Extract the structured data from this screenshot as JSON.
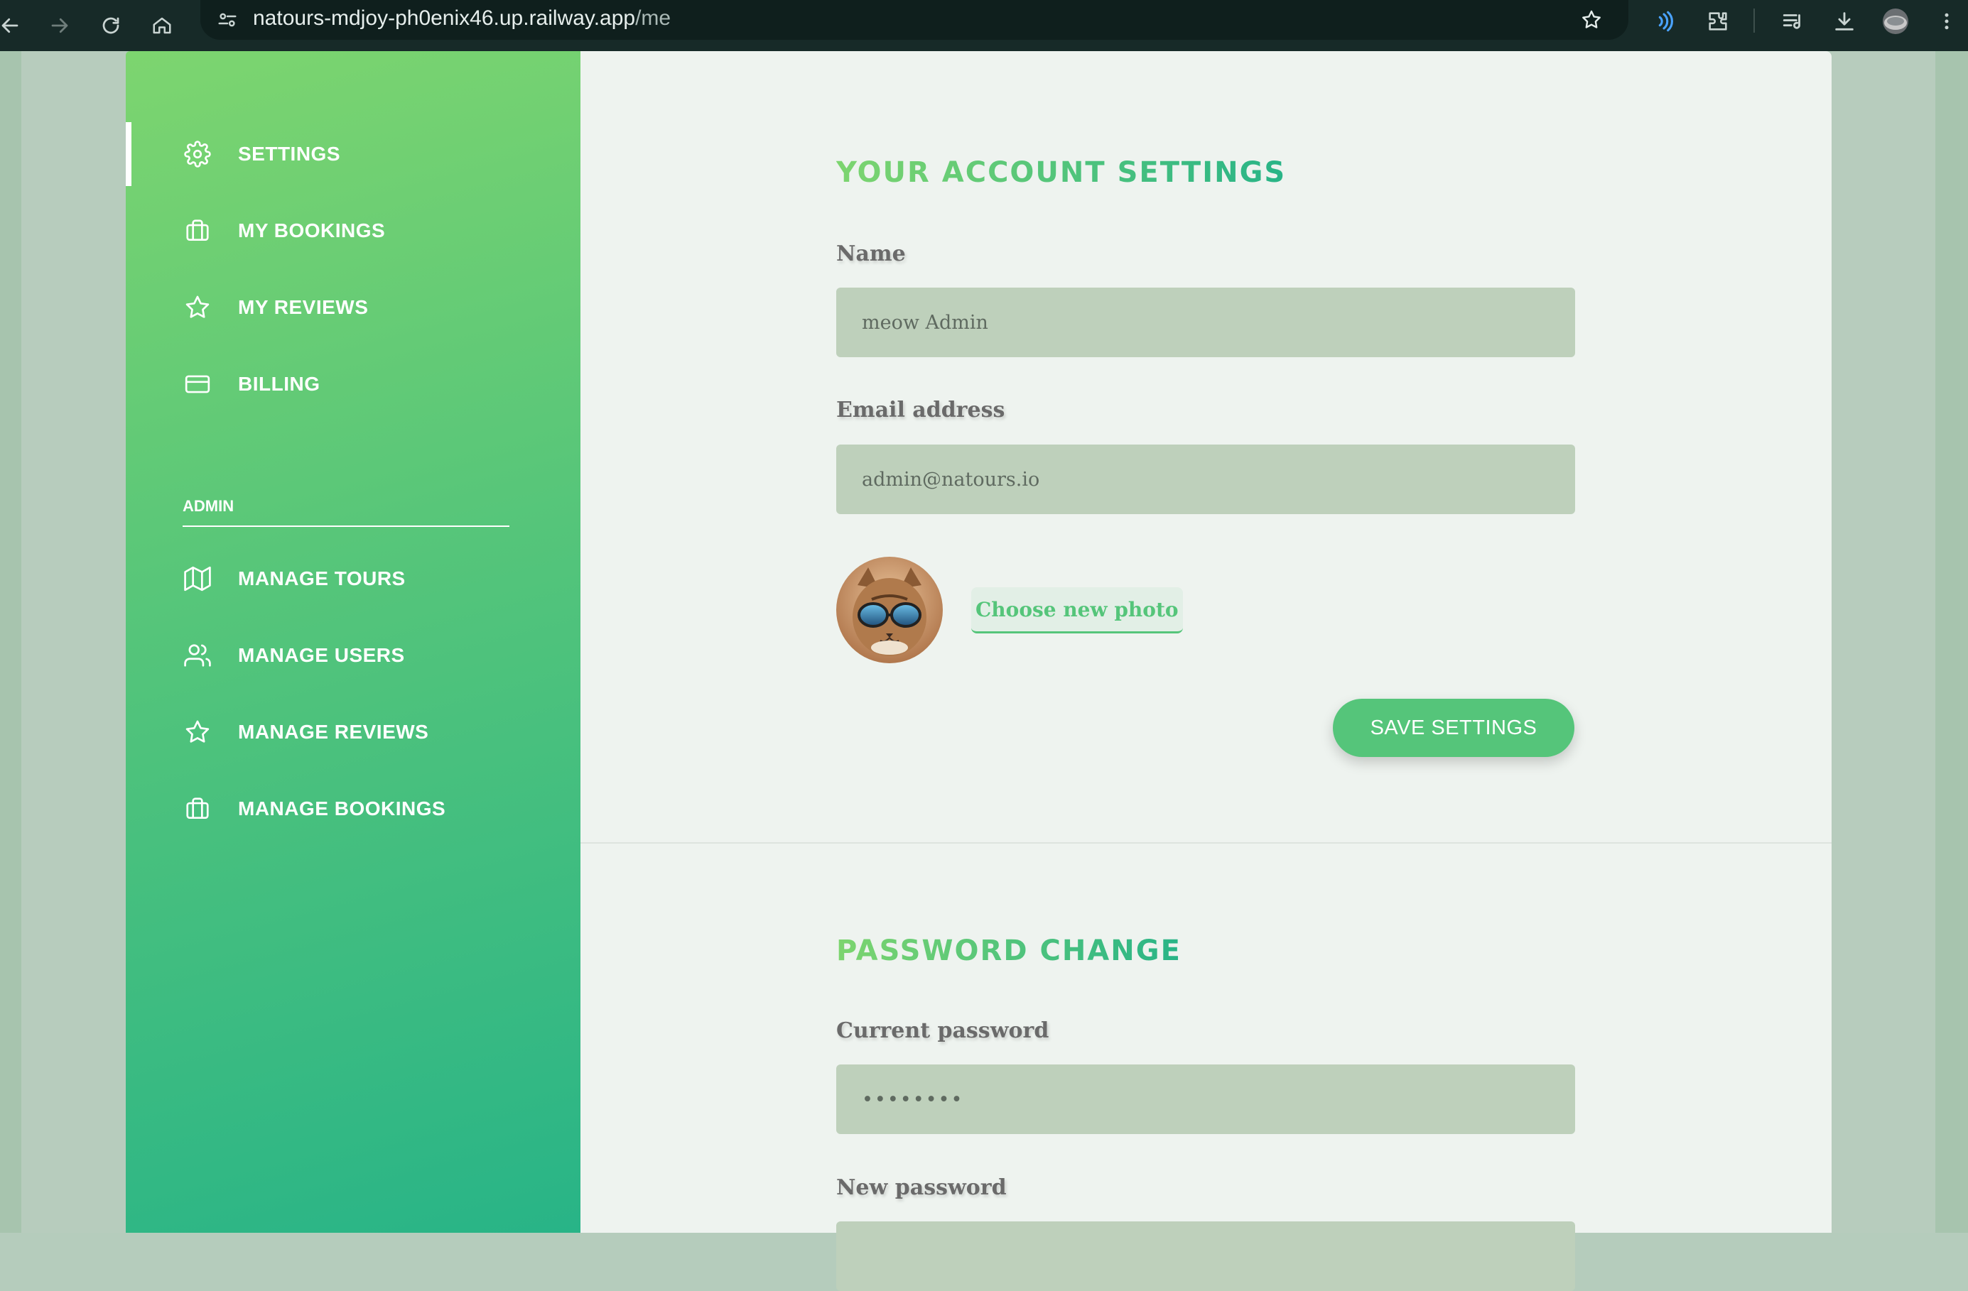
{
  "browser": {
    "url_host": "natours-mdjoy-ph0enix46.up.railway.app",
    "url_path": "/me"
  },
  "sidebar": {
    "items": [
      {
        "label": "SETTINGS",
        "icon": "gear-icon",
        "active": true
      },
      {
        "label": "MY BOOKINGS",
        "icon": "briefcase-icon"
      },
      {
        "label": "MY REVIEWS",
        "icon": "star-icon"
      },
      {
        "label": "BILLING",
        "icon": "credit-card-icon"
      }
    ],
    "admin_heading": "ADMIN",
    "admin_items": [
      {
        "label": "MANAGE TOURS",
        "icon": "map-icon"
      },
      {
        "label": "MANAGE USERS",
        "icon": "users-icon"
      },
      {
        "label": "MANAGE REVIEWS",
        "icon": "star-icon"
      },
      {
        "label": "MANAGE BOOKINGS",
        "icon": "briefcase-icon"
      }
    ]
  },
  "account": {
    "title": "YOUR ACCOUNT SETTINGS",
    "name_label": "Name",
    "name_value": "meow Admin",
    "email_label": "Email address",
    "email_value": "admin@natours.io",
    "photo_button": "Choose new photo",
    "save_button": "SAVE SETTINGS"
  },
  "password": {
    "title": "PASSWORD CHANGE",
    "current_label": "Current password",
    "current_value": "••••••••",
    "new_label": "New password"
  },
  "colors": {
    "brand_green": "#55c57a",
    "brand_light": "#7dd56f",
    "brand_dark": "#28b487",
    "input_bg": "#bed0bb",
    "browser_bar": "#172a28"
  }
}
